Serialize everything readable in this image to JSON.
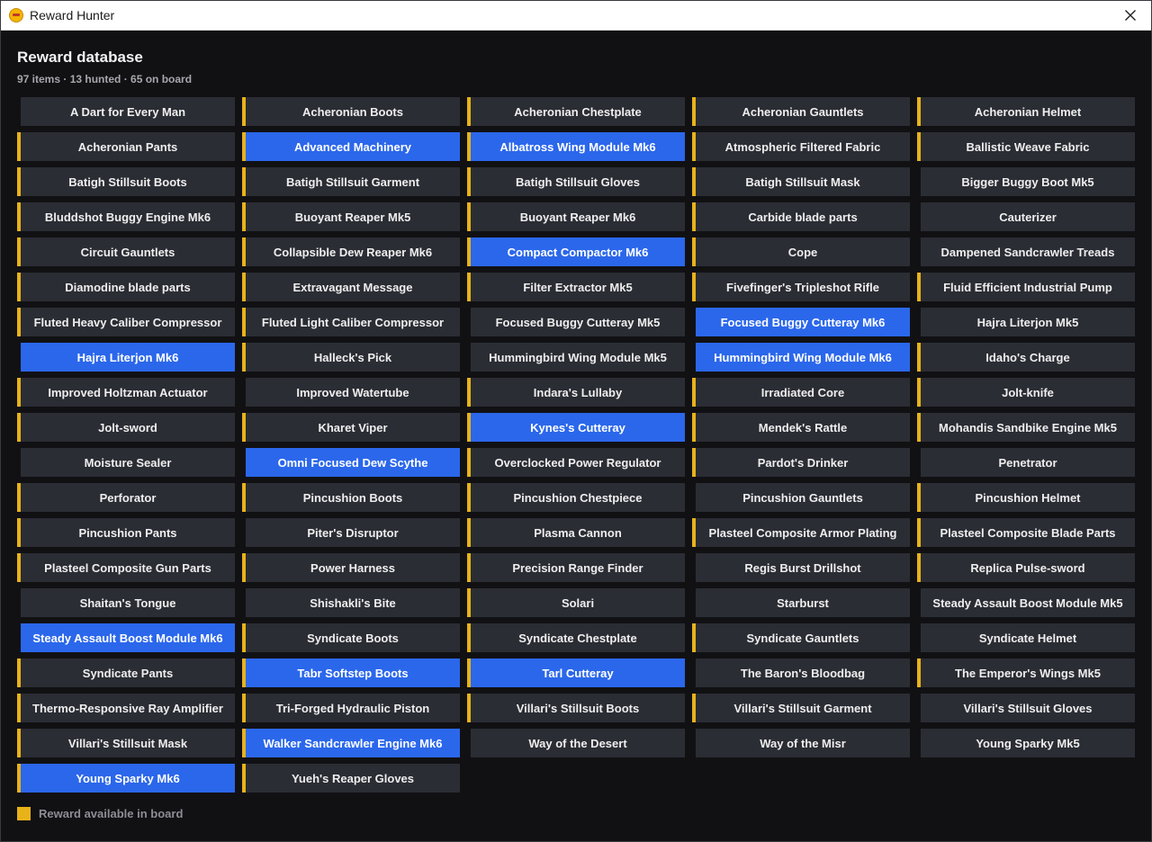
{
  "window": {
    "title": "Reward Hunter"
  },
  "header": {
    "title": "Reward database",
    "stats": "97 items · 13 hunted · 65 on board"
  },
  "colors": {
    "board_accent": "#e8b219",
    "hunted": "#2b67eb",
    "tile": "#2b2d34",
    "background": "#111114"
  },
  "items": [
    {
      "name": "A Dart for Every Man",
      "board": false,
      "hunted": false
    },
    {
      "name": "Acheronian Boots",
      "board": true,
      "hunted": false
    },
    {
      "name": "Acheronian Chestplate",
      "board": true,
      "hunted": false
    },
    {
      "name": "Acheronian Gauntlets",
      "board": true,
      "hunted": false
    },
    {
      "name": "Acheronian Helmet",
      "board": true,
      "hunted": false
    },
    {
      "name": "Acheronian Pants",
      "board": true,
      "hunted": false
    },
    {
      "name": "Advanced Machinery",
      "board": true,
      "hunted": true
    },
    {
      "name": "Albatross Wing Module Mk6",
      "board": true,
      "hunted": true
    },
    {
      "name": "Atmospheric Filtered Fabric",
      "board": true,
      "hunted": false
    },
    {
      "name": "Ballistic Weave Fabric",
      "board": true,
      "hunted": false
    },
    {
      "name": "Batigh Stillsuit Boots",
      "board": true,
      "hunted": false
    },
    {
      "name": "Batigh Stillsuit Garment",
      "board": true,
      "hunted": false
    },
    {
      "name": "Batigh Stillsuit Gloves",
      "board": true,
      "hunted": false
    },
    {
      "name": "Batigh Stillsuit Mask",
      "board": true,
      "hunted": false
    },
    {
      "name": "Bigger Buggy Boot Mk5",
      "board": false,
      "hunted": false
    },
    {
      "name": "Bluddshot Buggy Engine Mk6",
      "board": true,
      "hunted": false
    },
    {
      "name": "Buoyant Reaper Mk5",
      "board": true,
      "hunted": false
    },
    {
      "name": "Buoyant Reaper Mk6",
      "board": true,
      "hunted": false
    },
    {
      "name": "Carbide blade parts",
      "board": true,
      "hunted": false
    },
    {
      "name": "Cauterizer",
      "board": false,
      "hunted": false
    },
    {
      "name": "Circuit Gauntlets",
      "board": true,
      "hunted": false
    },
    {
      "name": "Collapsible Dew Reaper Mk6",
      "board": true,
      "hunted": false
    },
    {
      "name": "Compact Compactor Mk6",
      "board": true,
      "hunted": true
    },
    {
      "name": "Cope",
      "board": true,
      "hunted": false
    },
    {
      "name": "Dampened Sandcrawler Treads",
      "board": false,
      "hunted": false
    },
    {
      "name": "Diamodine blade parts",
      "board": true,
      "hunted": false
    },
    {
      "name": "Extravagant Message",
      "board": true,
      "hunted": false
    },
    {
      "name": "Filter Extractor Mk5",
      "board": true,
      "hunted": false
    },
    {
      "name": "Fivefinger's Tripleshot Rifle",
      "board": true,
      "hunted": false
    },
    {
      "name": "Fluid Efficient Industrial Pump",
      "board": true,
      "hunted": false
    },
    {
      "name": "Fluted Heavy Caliber Compressor",
      "board": true,
      "hunted": false
    },
    {
      "name": "Fluted Light Caliber Compressor",
      "board": true,
      "hunted": false
    },
    {
      "name": "Focused Buggy Cutteray Mk5",
      "board": false,
      "hunted": false
    },
    {
      "name": "Focused Buggy Cutteray Mk6",
      "board": false,
      "hunted": true
    },
    {
      "name": "Hajra Literjon Mk5",
      "board": false,
      "hunted": false
    },
    {
      "name": "Hajra Literjon Mk6",
      "board": false,
      "hunted": true
    },
    {
      "name": "Halleck's Pick",
      "board": true,
      "hunted": false
    },
    {
      "name": "Hummingbird Wing Module Mk5",
      "board": false,
      "hunted": false
    },
    {
      "name": "Hummingbird Wing Module Mk6",
      "board": false,
      "hunted": true
    },
    {
      "name": "Idaho's Charge",
      "board": true,
      "hunted": false
    },
    {
      "name": "Improved Holtzman Actuator",
      "board": true,
      "hunted": false
    },
    {
      "name": "Improved Watertube",
      "board": false,
      "hunted": false
    },
    {
      "name": "Indara's Lullaby",
      "board": true,
      "hunted": false
    },
    {
      "name": "Irradiated Core",
      "board": true,
      "hunted": false
    },
    {
      "name": "Jolt-knife",
      "board": true,
      "hunted": false
    },
    {
      "name": "Jolt-sword",
      "board": true,
      "hunted": false
    },
    {
      "name": "Kharet Viper",
      "board": true,
      "hunted": false
    },
    {
      "name": "Kynes's Cutteray",
      "board": true,
      "hunted": true
    },
    {
      "name": "Mendek's Rattle",
      "board": true,
      "hunted": false
    },
    {
      "name": "Mohandis Sandbike Engine Mk5",
      "board": true,
      "hunted": false
    },
    {
      "name": "Moisture Sealer",
      "board": false,
      "hunted": false
    },
    {
      "name": "Omni Focused Dew Scythe",
      "board": false,
      "hunted": true
    },
    {
      "name": "Overclocked Power Regulator",
      "board": true,
      "hunted": false
    },
    {
      "name": "Pardot's Drinker",
      "board": true,
      "hunted": false
    },
    {
      "name": "Penetrator",
      "board": false,
      "hunted": false
    },
    {
      "name": "Perforator",
      "board": true,
      "hunted": false
    },
    {
      "name": "Pincushion Boots",
      "board": true,
      "hunted": false
    },
    {
      "name": "Pincushion Chestpiece",
      "board": true,
      "hunted": false
    },
    {
      "name": "Pincushion Gauntlets",
      "board": false,
      "hunted": false
    },
    {
      "name": "Pincushion Helmet",
      "board": true,
      "hunted": false
    },
    {
      "name": "Pincushion Pants",
      "board": true,
      "hunted": false
    },
    {
      "name": "Piter's Disruptor",
      "board": false,
      "hunted": false
    },
    {
      "name": "Plasma Cannon",
      "board": true,
      "hunted": false
    },
    {
      "name": "Plasteel Composite Armor Plating",
      "board": true,
      "hunted": false
    },
    {
      "name": "Plasteel Composite Blade Parts",
      "board": true,
      "hunted": false
    },
    {
      "name": "Plasteel Composite Gun Parts",
      "board": true,
      "hunted": false
    },
    {
      "name": "Power Harness",
      "board": true,
      "hunted": false
    },
    {
      "name": "Precision Range Finder",
      "board": true,
      "hunted": false
    },
    {
      "name": "Regis Burst Drillshot",
      "board": false,
      "hunted": false
    },
    {
      "name": "Replica Pulse-sword",
      "board": true,
      "hunted": false
    },
    {
      "name": "Shaitan's Tongue",
      "board": false,
      "hunted": false
    },
    {
      "name": "Shishakli's Bite",
      "board": false,
      "hunted": false
    },
    {
      "name": "Solari",
      "board": true,
      "hunted": false
    },
    {
      "name": "Starburst",
      "board": false,
      "hunted": false
    },
    {
      "name": "Steady Assault Boost Module Mk5",
      "board": false,
      "hunted": false
    },
    {
      "name": "Steady Assault Boost Module Mk6",
      "board": false,
      "hunted": true
    },
    {
      "name": "Syndicate Boots",
      "board": true,
      "hunted": false
    },
    {
      "name": "Syndicate Chestplate",
      "board": true,
      "hunted": false
    },
    {
      "name": "Syndicate Gauntlets",
      "board": true,
      "hunted": false
    },
    {
      "name": "Syndicate Helmet",
      "board": false,
      "hunted": false
    },
    {
      "name": "Syndicate Pants",
      "board": true,
      "hunted": false
    },
    {
      "name": "Tabr Softstep Boots",
      "board": true,
      "hunted": true
    },
    {
      "name": "Tarl Cutteray",
      "board": true,
      "hunted": true
    },
    {
      "name": "The Baron's Bloodbag",
      "board": false,
      "hunted": false
    },
    {
      "name": "The Emperor's Wings Mk5",
      "board": true,
      "hunted": false
    },
    {
      "name": "Thermo-Responsive Ray Amplifier",
      "board": true,
      "hunted": false
    },
    {
      "name": "Tri-Forged Hydraulic Piston",
      "board": true,
      "hunted": false
    },
    {
      "name": "Villari's Stillsuit Boots",
      "board": true,
      "hunted": false
    },
    {
      "name": "Villari's Stillsuit Garment",
      "board": true,
      "hunted": false
    },
    {
      "name": "Villari's Stillsuit Gloves",
      "board": false,
      "hunted": false
    },
    {
      "name": "Villari's Stillsuit Mask",
      "board": true,
      "hunted": false
    },
    {
      "name": "Walker Sandcrawler Engine Mk6",
      "board": true,
      "hunted": true
    },
    {
      "name": "Way of the Desert",
      "board": false,
      "hunted": false
    },
    {
      "name": "Way of the Misr",
      "board": false,
      "hunted": false
    },
    {
      "name": "Young Sparky Mk5",
      "board": false,
      "hunted": false
    },
    {
      "name": "Young Sparky Mk6",
      "board": true,
      "hunted": true
    },
    {
      "name": "Yueh's Reaper Gloves",
      "board": true,
      "hunted": false
    }
  ],
  "legend": {
    "label": "Reward available in board"
  }
}
